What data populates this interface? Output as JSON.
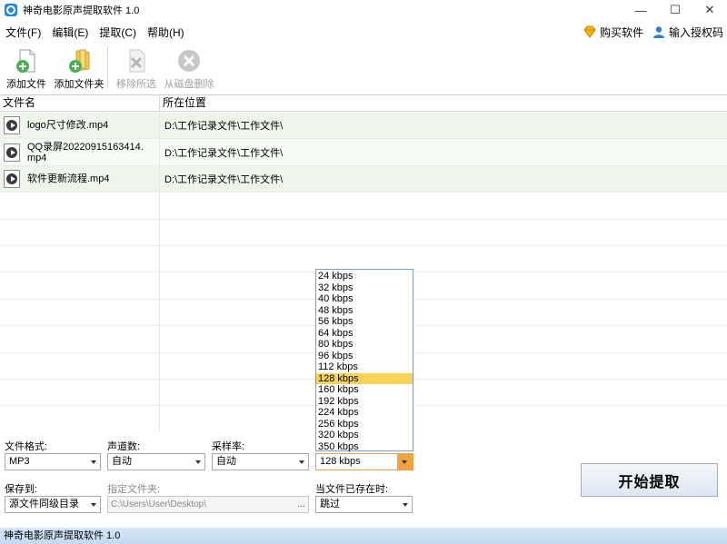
{
  "window": {
    "title": "神奇电影原声提取软件 1.0",
    "minimize": "—",
    "maximize": "☐",
    "close": "✕"
  },
  "menu": {
    "items": [
      "文件(F)",
      "编辑(E)",
      "提取(C)",
      "帮助(H)"
    ],
    "buy": "购买软件",
    "license": "输入授权码"
  },
  "toolbar": {
    "add_file": "添加文件",
    "add_folder": "添加文件夹",
    "remove_selected": "移除所选",
    "delete_from_disk": "从磁盘删除"
  },
  "list": {
    "col_name": "文件名",
    "col_location": "所在位置",
    "files": [
      {
        "name": "logo尺寸修改.mp4",
        "location": "D:\\工作记录文件\\工作文件\\"
      },
      {
        "name": "QQ录屏20220915163414.mp4",
        "location": "D:\\工作记录文件\\工作文件\\"
      },
      {
        "name": "软件更新流程.mp4",
        "location": "D:\\工作记录文件\\工作文件\\"
      }
    ]
  },
  "bitrate_options": [
    "24 kbps",
    "32 kbps",
    "40 kbps",
    "48 kbps",
    "56 kbps",
    "64 kbps",
    "80 kbps",
    "96 kbps",
    "112 kbps",
    "128 kbps",
    "160 kbps",
    "192 kbps",
    "224 kbps",
    "256 kbps",
    "320 kbps",
    "350 kbps"
  ],
  "settings": {
    "format_label": "文件格式:",
    "format_value": "MP3",
    "channels_label": "声道数:",
    "channels_value": "自动",
    "samplerate_label": "采样率:",
    "samplerate_value": "自动",
    "bitrate_value": "128 kbps",
    "saveto_label": "保存到:",
    "saveto_value": "源文件同级目录",
    "folder_label": "指定文件夹:",
    "folder_value": "C:\\Users\\User\\Desktop\\",
    "browse": "...",
    "exists_label": "当文件已存在时:",
    "exists_value": "跳过",
    "start_button": "开始提取"
  },
  "status": {
    "text": "神奇电影原声提取软件 1.0"
  },
  "colors": {
    "accent": "#1e88e5",
    "selected": "#f7d35a",
    "row_fill": "#eef6ec",
    "status_bg": "#c5d9ef"
  }
}
